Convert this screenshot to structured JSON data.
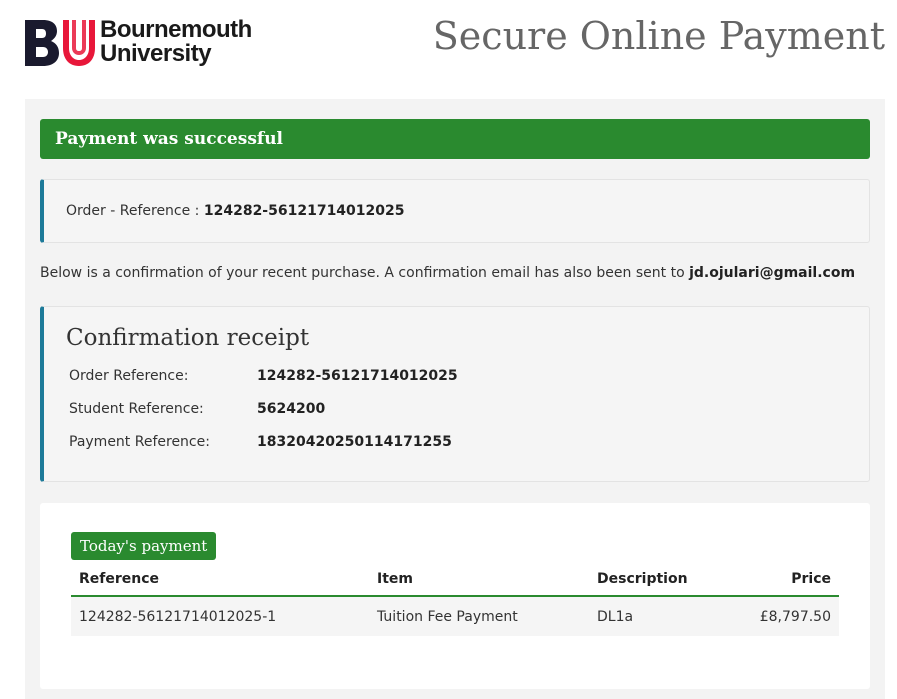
{
  "header": {
    "logo_line1": "Bournemouth",
    "logo_line2": "University",
    "logo_mark": "BU",
    "title": "Secure Online Payment"
  },
  "status": {
    "message": "Payment was successful"
  },
  "order": {
    "label": "Order - Reference : ",
    "value": "124282-56121714012025"
  },
  "confirmation": {
    "text": "Below is a confirmation of your recent purchase. A confirmation email has also been sent to ",
    "email": "jd.ojulari@gmail.com"
  },
  "receipt": {
    "title": "Confirmation receipt",
    "rows": [
      {
        "label": "Order Reference:",
        "value": "124282-56121714012025"
      },
      {
        "label": "Student Reference:",
        "value": "5624200"
      },
      {
        "label": "Payment Reference:",
        "value": "18320420250114171255"
      }
    ]
  },
  "payment": {
    "badge": "Today's payment",
    "headers": {
      "reference": "Reference",
      "item": "Item",
      "description": "Description",
      "price": "Price"
    },
    "rows": [
      {
        "reference": "124282-56121714012025-1",
        "item": "Tuition Fee Payment",
        "description": "DL1a",
        "price": "£8,797.50"
      }
    ]
  },
  "colors": {
    "success_green": "#2a8a2f",
    "accent_blue": "#1d7a99",
    "logo_red": "#e8173a",
    "logo_dark": "#1a1a2e"
  }
}
